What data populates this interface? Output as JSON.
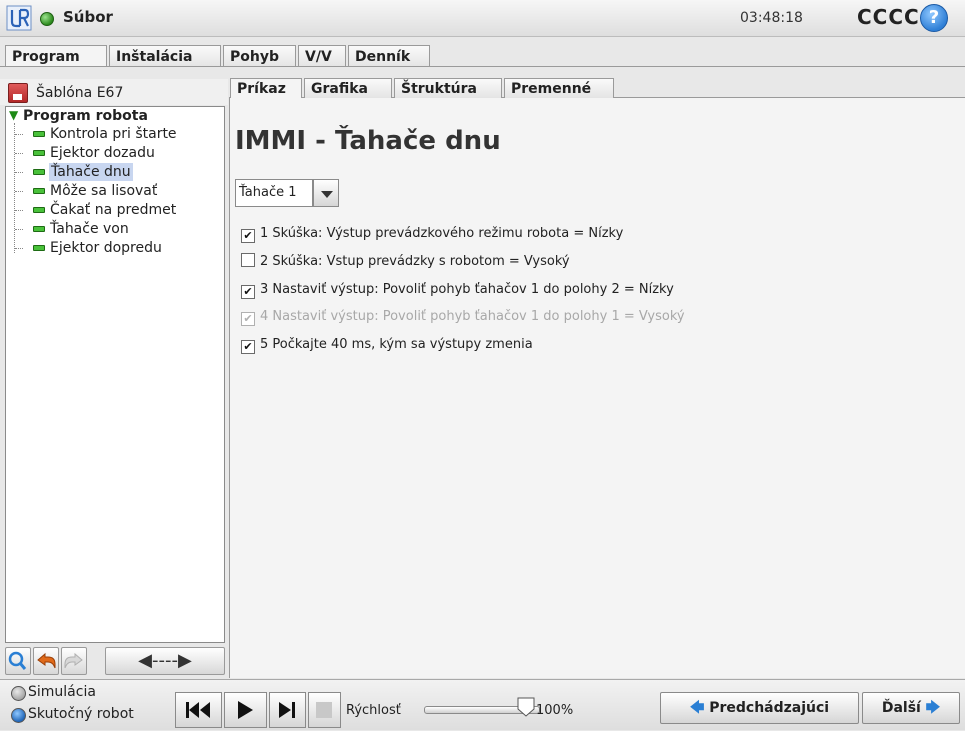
{
  "header": {
    "file_title": "Súbor",
    "clock": "03:48:18",
    "robot_name": "CCCC",
    "help_glyph": "?"
  },
  "main_tabs": [
    {
      "label": "Program",
      "active": true
    },
    {
      "label": "Inštalácia",
      "active": false
    },
    {
      "label": "Pohyb",
      "active": false
    },
    {
      "label": "V/V",
      "active": false
    },
    {
      "label": "Denník",
      "active": false
    }
  ],
  "left_panel": {
    "template_name": "Šablóna E67",
    "tree": {
      "root": "Program robota",
      "items": [
        {
          "label": "Kontrola pri štarte",
          "selected": false
        },
        {
          "label": "Ejektor dozadu",
          "selected": false
        },
        {
          "label": "Ťahače dnu",
          "selected": true
        },
        {
          "label": "Môže sa lisovať",
          "selected": false
        },
        {
          "label": "Čakať na predmet",
          "selected": false
        },
        {
          "label": "Ťahače von",
          "selected": false
        },
        {
          "label": "Ejektor dopredu",
          "selected": false
        }
      ]
    },
    "toolbar_move_glyph": "◀----▶"
  },
  "sub_tabs": [
    {
      "label": "Príkaz",
      "active": true
    },
    {
      "label": "Grafika",
      "active": false
    },
    {
      "label": "Štruktúra",
      "active": false
    },
    {
      "label": "Premenné",
      "active": false
    }
  ],
  "content": {
    "title": "IMMI - Ťahače dnu",
    "select_value": "Ťahače 1",
    "rows": [
      {
        "text": "1 Skúška: Výstup prevádzkového režimu robota = Nízky",
        "checked": true,
        "disabled": false
      },
      {
        "text": "2 Skúška: Vstup prevádzky s robotom = Vysoký",
        "checked": false,
        "disabled": false
      },
      {
        "text": "3 Nastaviť výstup: Povoliť pohyb ťahačov 1 do polohy 2 = Nízky",
        "checked": true,
        "disabled": false
      },
      {
        "text": "4 Nastaviť výstup: Povoliť pohyb ťahačov 1 do polohy 1 = Vysoký",
        "checked": true,
        "disabled": true
      },
      {
        "text": "5 Počkajte 40 ms, kým sa výstupy zmenia",
        "checked": true,
        "disabled": false
      }
    ]
  },
  "bottom": {
    "simulation_label": "Simulácia",
    "real_robot_label": "Skutočný robot",
    "speed_label": "Rýchlosť",
    "speed_value": "100%",
    "speed_fraction": 1.0,
    "prev_label": "Predchádzajúci",
    "next_label": "Ďalší"
  },
  "colors": {
    "accent_blue": "#2a7fd4",
    "status_green": "#2c8a1d",
    "selection": "#c8d6f0"
  }
}
